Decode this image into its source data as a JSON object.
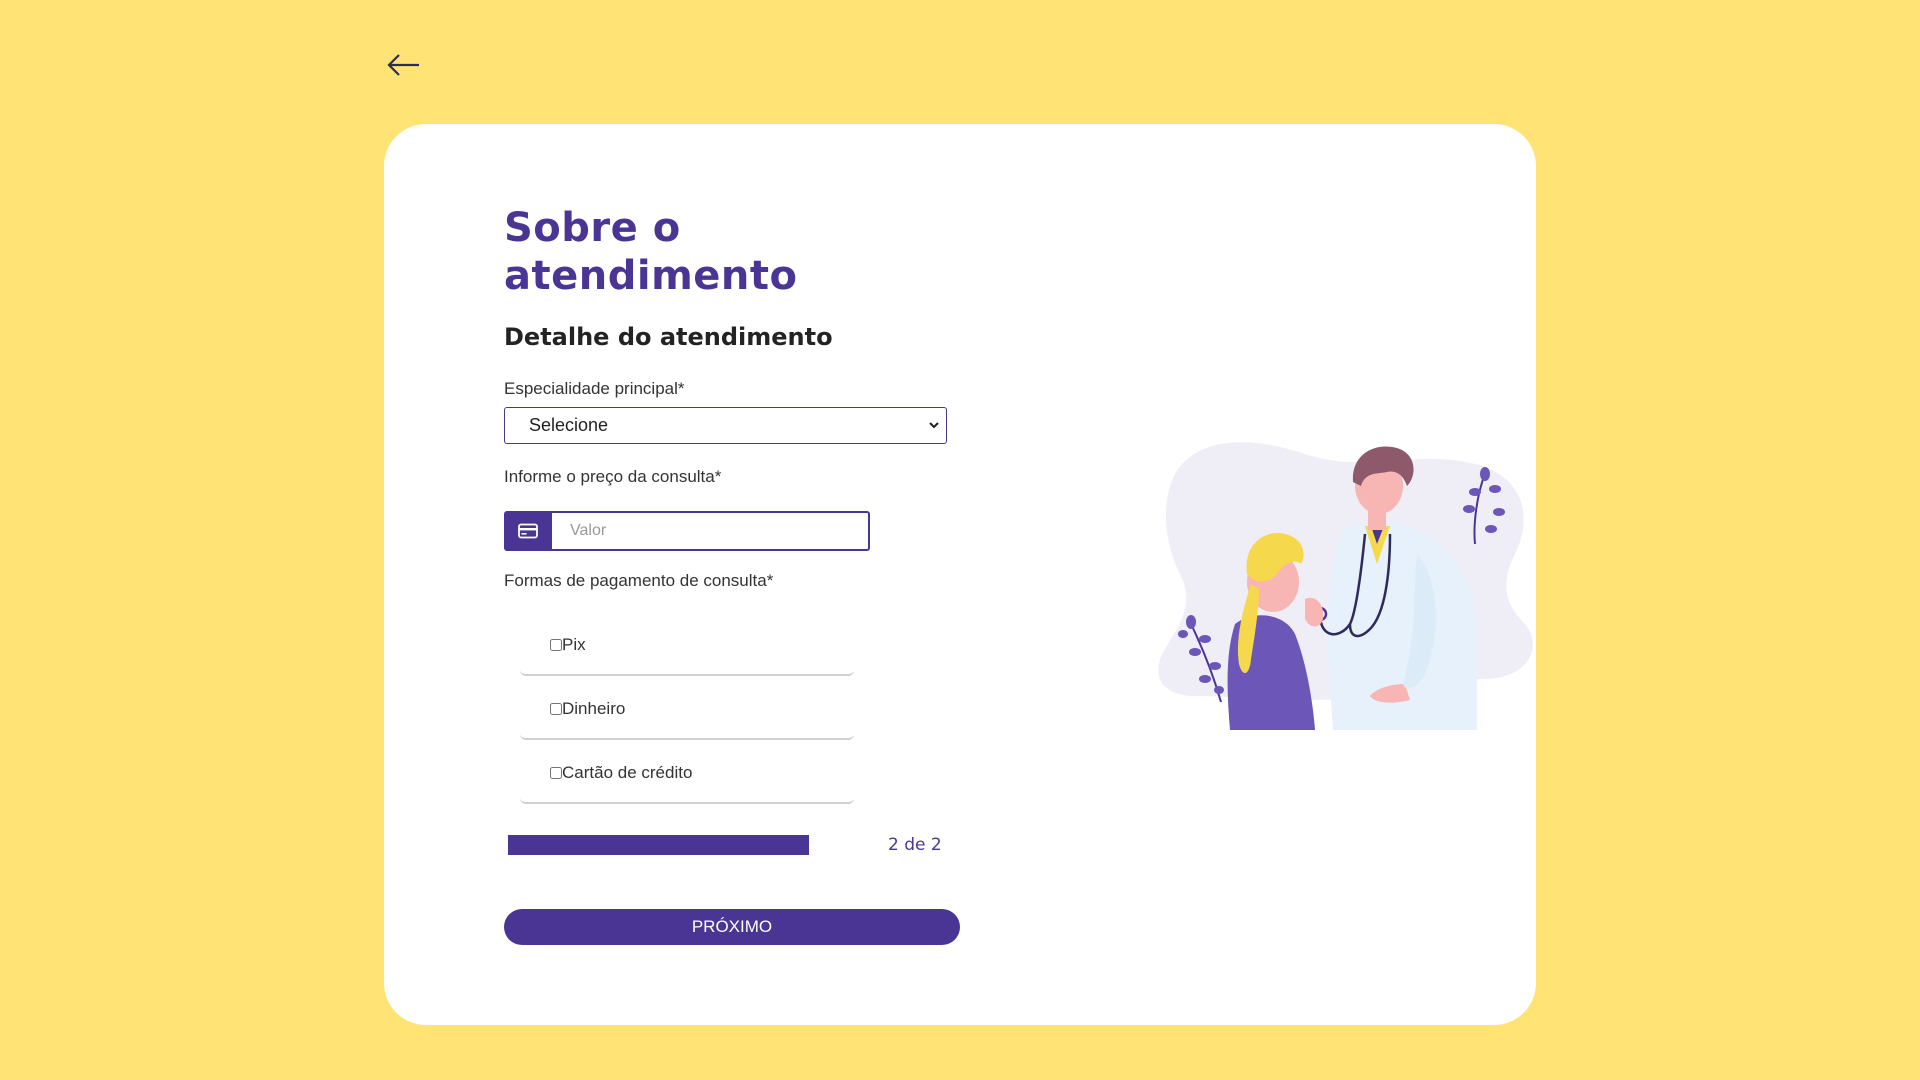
{
  "header": {
    "back_icon": "arrow-left-icon"
  },
  "form": {
    "title": "Sobre o atendimento",
    "subtitle": "Detalhe do atendimento",
    "specialty": {
      "label": "Especialidade principal*",
      "selected": "Selecione"
    },
    "price": {
      "label": "Informe o preço da consulta*",
      "placeholder": "Valor",
      "icon": "credit-card-icon"
    },
    "payment": {
      "label": "Formas de pagamento de consulta*",
      "options": [
        {
          "label": "Pix",
          "checked": false
        },
        {
          "label": "Dinheiro",
          "checked": false
        },
        {
          "label": "Cartão de crédito",
          "checked": false
        }
      ]
    }
  },
  "progress": {
    "value": 1.0,
    "text": "2 de 2"
  },
  "actions": {
    "next_label": "PRÓXIMO"
  },
  "illustration": {
    "name": "doctor-and-patient-illustration"
  },
  "colors": {
    "background": "#FFE475",
    "card": "#FFFFFF",
    "accent": "#4B3594"
  }
}
